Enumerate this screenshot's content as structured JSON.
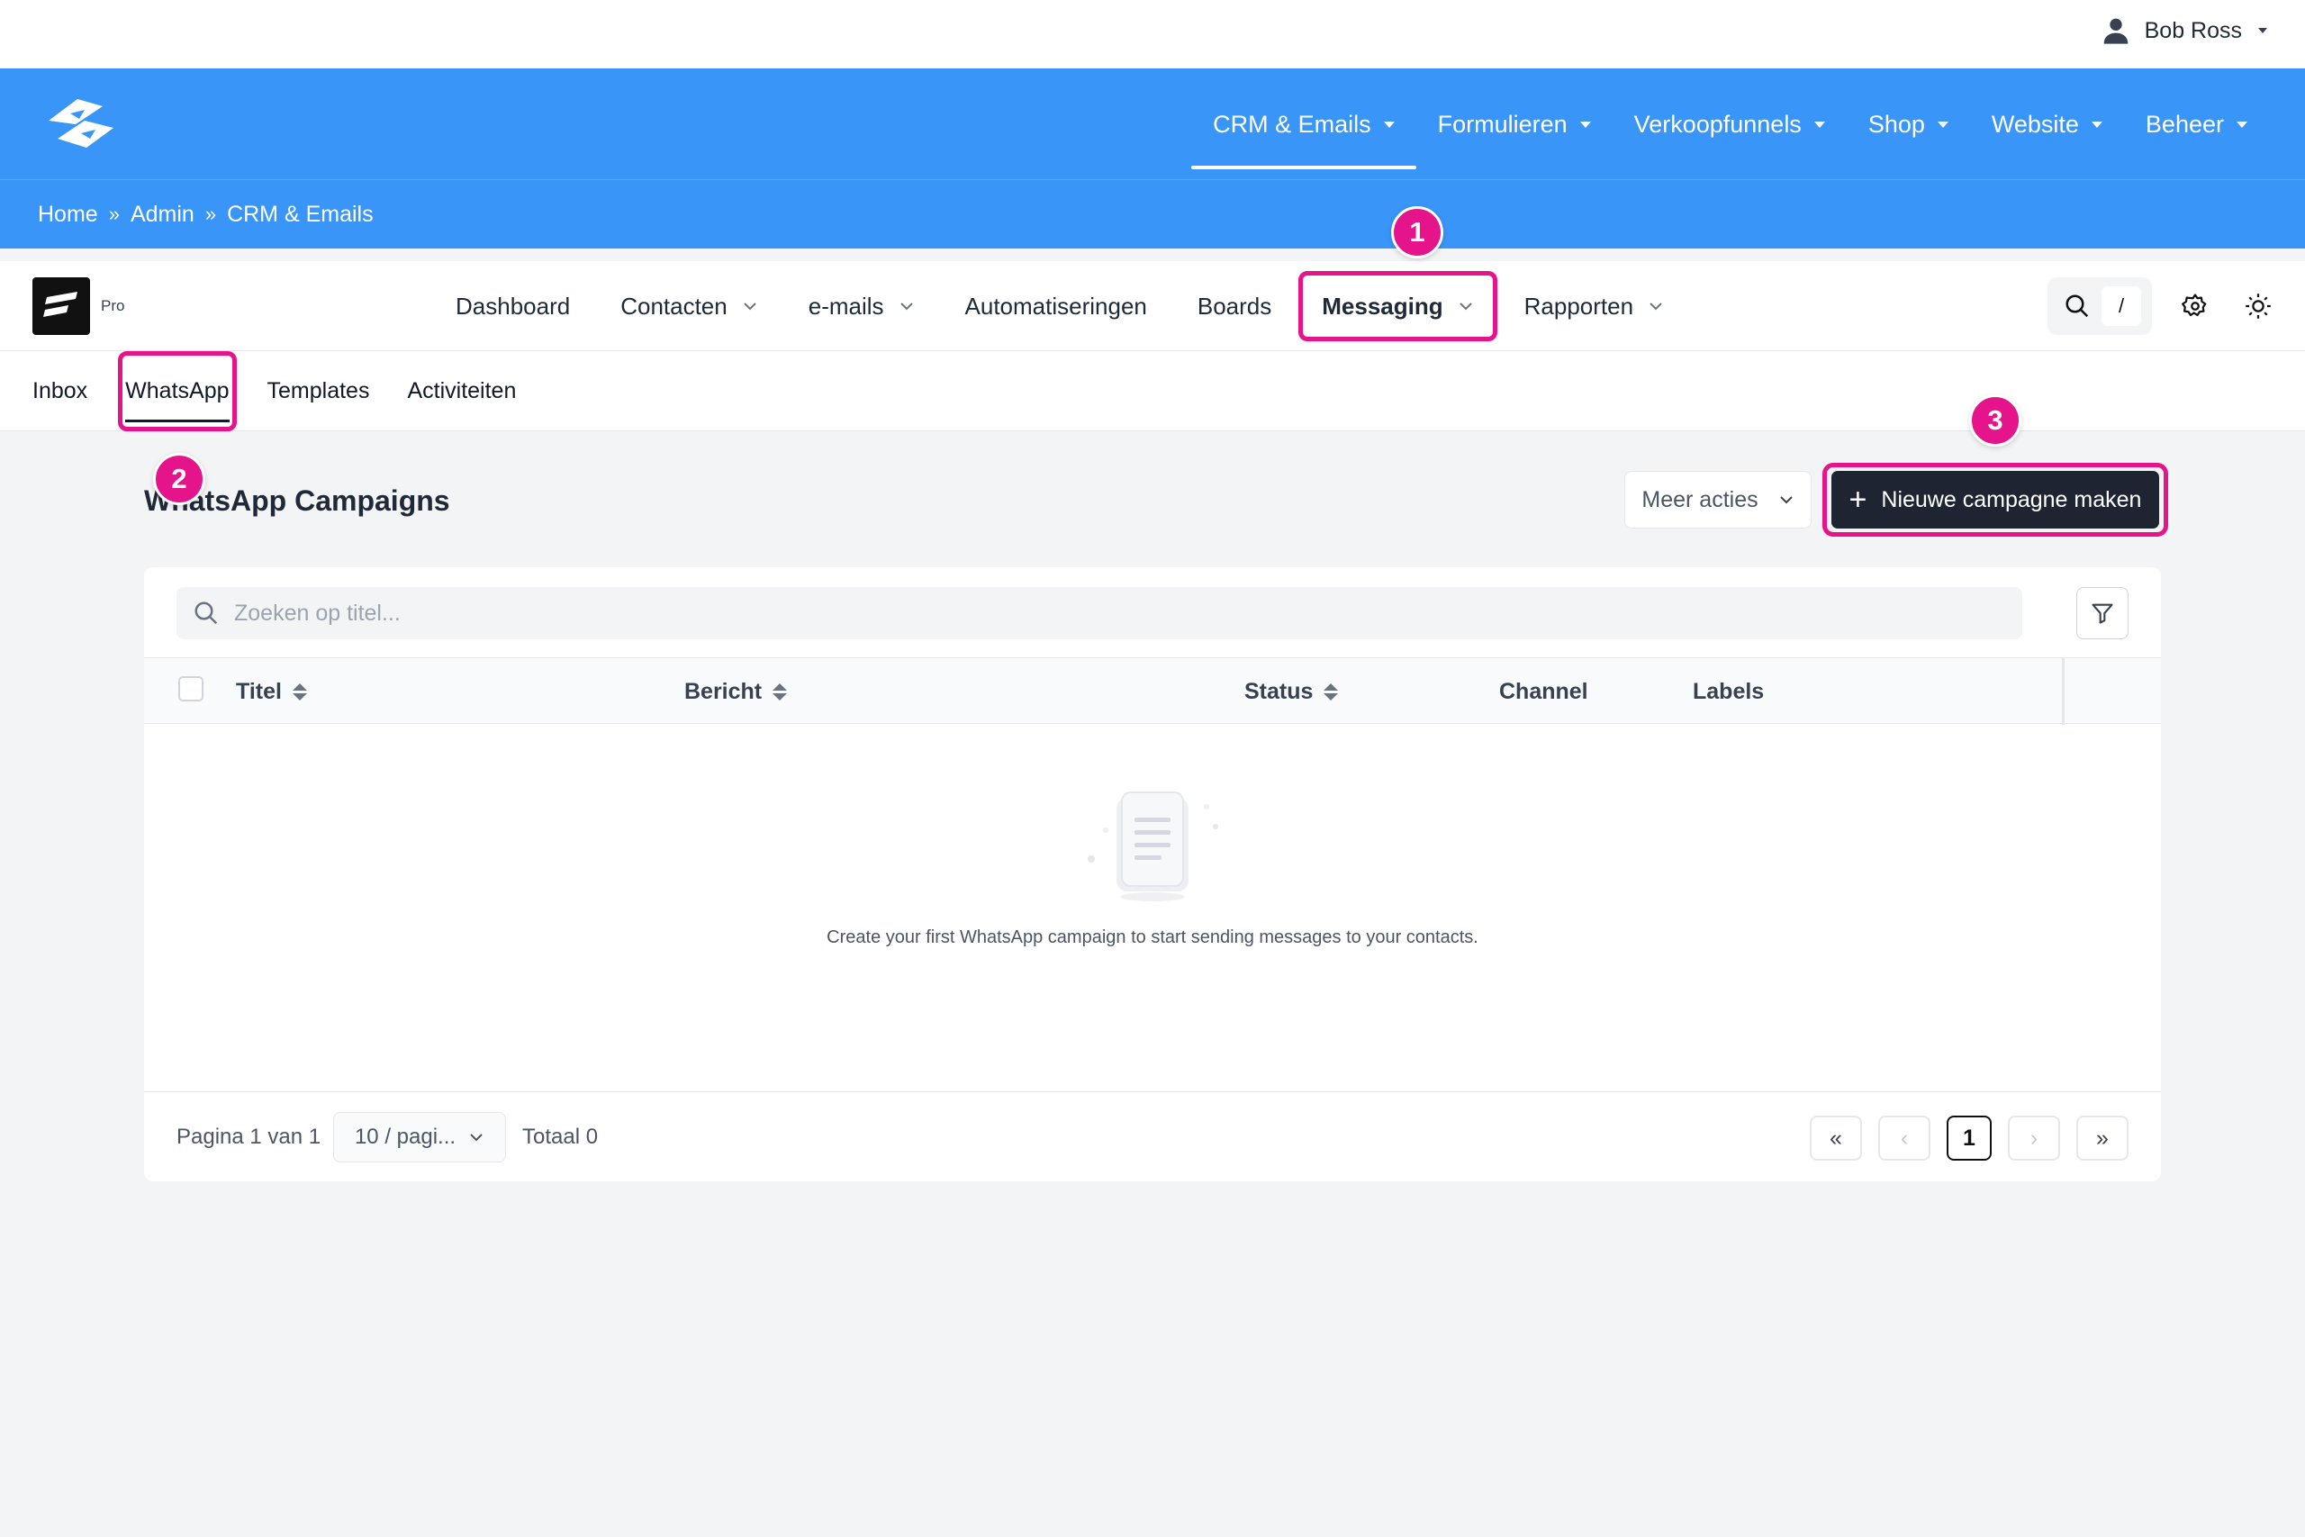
{
  "user": {
    "name": "Bob Ross",
    "icon": "person-icon"
  },
  "main_nav": [
    {
      "label": "CRM & Emails",
      "active": true
    },
    {
      "label": "Formulieren"
    },
    {
      "label": "Verkoopfunnels"
    },
    {
      "label": "Shop"
    },
    {
      "label": "Website"
    },
    {
      "label": "Beheer"
    }
  ],
  "breadcrumb": [
    "Home",
    "Admin",
    "CRM & Emails"
  ],
  "breadcrumb_sep": "»",
  "app": {
    "badge_label": "Pro",
    "nav": [
      {
        "label": "Dashboard"
      },
      {
        "label": "Contacten",
        "dropdown": true
      },
      {
        "label": "e-mails",
        "dropdown": true
      },
      {
        "label": "Automatiseringen"
      },
      {
        "label": "Boards"
      },
      {
        "label": "Messaging",
        "dropdown": true,
        "highlighted": true
      },
      {
        "label": "Rapporten",
        "dropdown": true
      }
    ],
    "search_shortcut": "/"
  },
  "subtabs": [
    {
      "label": "Inbox"
    },
    {
      "label": "WhatsApp",
      "active": true,
      "highlighted": true
    },
    {
      "label": "Templates"
    },
    {
      "label": "Activiteiten"
    }
  ],
  "callouts": [
    "1",
    "2",
    "3"
  ],
  "page": {
    "title": "WhatsApp Campaigns",
    "more_actions": "Meer acties",
    "new_button": "Nieuwe campagne maken",
    "new_button_icon": "+"
  },
  "table": {
    "search_placeholder": "Zoeken op titel...",
    "columns": [
      {
        "label": "Titel",
        "sortable": true
      },
      {
        "label": "Bericht",
        "sortable": true
      },
      {
        "label": "Status",
        "sortable": true
      },
      {
        "label": "Channel",
        "sortable": false
      },
      {
        "label": "Labels",
        "sortable": false
      }
    ],
    "rows": [],
    "empty_message": "Create your first WhatsApp campaign to start sending messages to your contacts."
  },
  "pagination": {
    "page_info": "Pagina 1 van 1",
    "page_size": "10 / pagi...",
    "total": "Totaal 0",
    "first": "«",
    "prev": "‹",
    "current": "1",
    "next": "›",
    "last": "»"
  },
  "colors": {
    "brand_blue": "#3a95f8",
    "highlight": "#e6148b",
    "primary_button": "#1f2433"
  }
}
